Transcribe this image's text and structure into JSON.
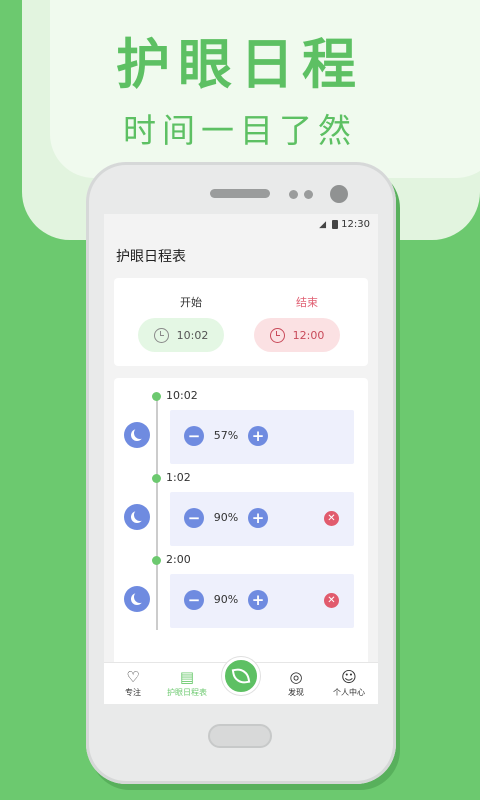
{
  "hero": {
    "title": "护眼日程",
    "subtitle": "时间一目了然"
  },
  "status_bar": {
    "time": "12:30"
  },
  "screen": {
    "title": "护眼日程表"
  },
  "range": {
    "start_label": "开始",
    "start_time": "10:02",
    "end_label": "结束",
    "end_time": "12:00"
  },
  "schedule": [
    {
      "time": "10:02",
      "brightness": "57%",
      "deletable": false
    },
    {
      "time": "1:02",
      "brightness": "90%",
      "deletable": true
    },
    {
      "time": "2:00",
      "brightness": "90%",
      "deletable": true
    }
  ],
  "tabs": [
    {
      "label": "专注",
      "icon": "heart-icon"
    },
    {
      "label": "护眼日程表",
      "icon": "calendar-icon",
      "active": true
    },
    {
      "label": "",
      "icon": "leaf-icon"
    },
    {
      "label": "发现",
      "icon": "planet-icon"
    },
    {
      "label": "个人中心",
      "icon": "person-icon"
    }
  ],
  "colors": {
    "brand_green": "#6cc96f",
    "accent_blue": "#6f8be0",
    "delete_red": "#e15b6d",
    "end_pink": "#e06073"
  }
}
